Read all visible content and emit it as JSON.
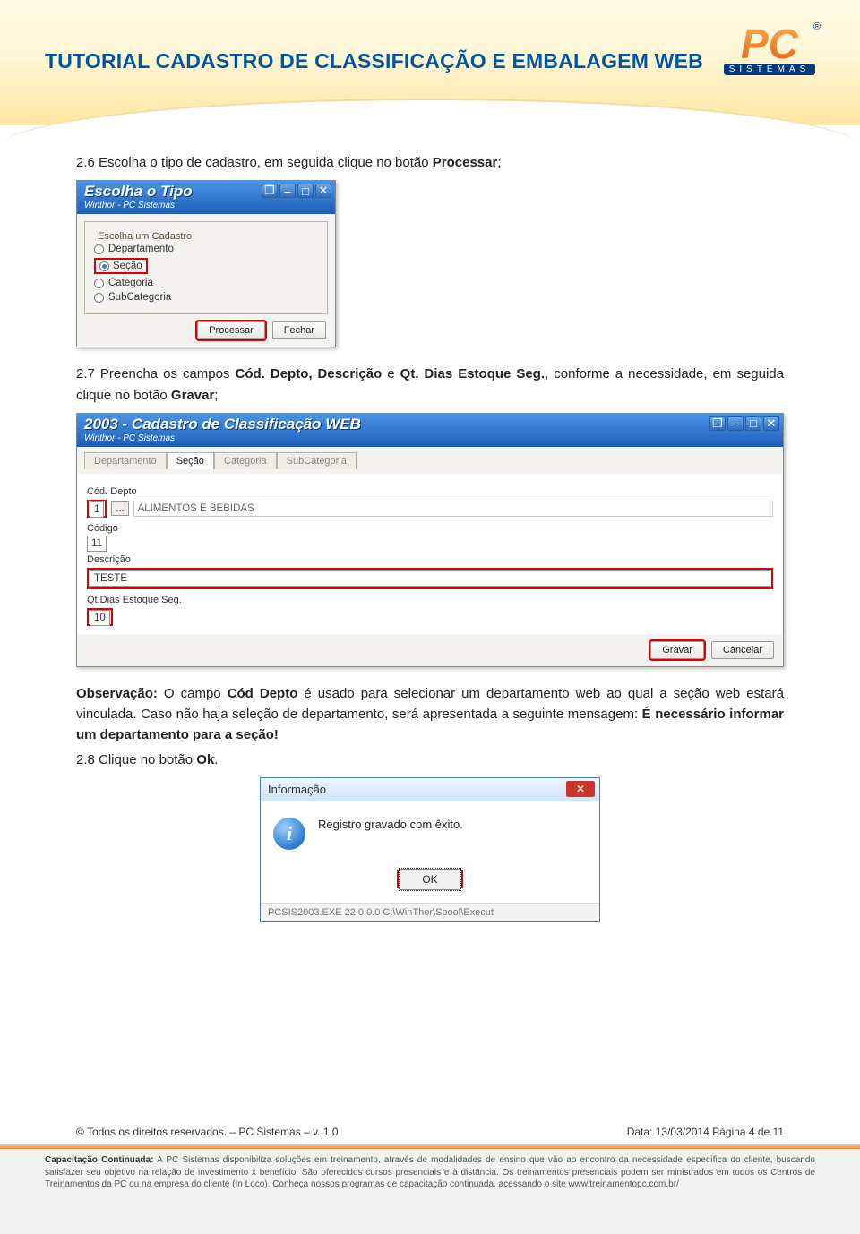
{
  "header": {
    "title": "TUTORIAL CADASTRO DE CLASSIFICAÇÃO E EMBALAGEM WEB",
    "logo_top": "PC",
    "logo_sub": "SISTEMAS"
  },
  "section26": {
    "prefix": "2.6 Escolha o tipo de cadastro, em seguida clique no botão ",
    "bold": "Processar",
    "suffix": ";"
  },
  "dialog1": {
    "title": "Escolha o Tipo",
    "subtitle": "Winthor - PC Sistemas",
    "group_label": "Escolha um Cadastro",
    "options": {
      "departamento": "Departamento",
      "secao": "Seção",
      "categoria": "Categoria",
      "subcategoria": "SubCategoria"
    },
    "btn_process": "Processar",
    "btn_close": "Fechar"
  },
  "section27": {
    "pre": "2.7 Preencha os campos ",
    "b1": "Cód. Depto, Descrição",
    "mid": " e ",
    "b2": "Qt. Dias Estoque Seg.",
    "after": ", conforme a necessidade, em seguida clique no botão ",
    "b3": "Gravar",
    "end": ";"
  },
  "dialog2": {
    "title": "2003 - Cadastro de Classificação WEB",
    "subtitle": "Winthor - PC Sistemas",
    "tabs": {
      "departamento": "Departamento",
      "secao": "Seção",
      "categoria": "Categoria",
      "subcategoria": "SubCategoria"
    },
    "labels": {
      "coddepto": "Cód. Depto",
      "codigo": "Código",
      "descricao": "Descrição",
      "qtdias": "Qt.Dias Estoque Seg."
    },
    "values": {
      "coddepto": "1",
      "lookup_btn": "...",
      "depto_name": "ALIMENTOS E BEBIDAS",
      "codigo": "11",
      "descricao": "TESTE",
      "qtdias": "10"
    },
    "btn_save": "Gravar",
    "btn_cancel": "Cancelar"
  },
  "obs": {
    "label": "Observação:",
    "t1": " O campo ",
    "b1": "Cód Depto",
    "t2": " é usado para selecionar um departamento web ao qual a seção web estará vinculada. Caso não haja seleção de departamento, será apresentada a seguinte mensagem: ",
    "b2": "É necessário informar um departamento para a seção!"
  },
  "section28": {
    "pre": "2.8 Clique no botão ",
    "bold": "Ok",
    "suffix": "."
  },
  "info": {
    "title": "Informação",
    "msg": "Registro gravado com êxito.",
    "ok": "OK",
    "status": "PCSIS2003.EXE 22.0.0.0 C:\\WinThor\\Spool\\Execut"
  },
  "footer": {
    "copy_left": "© Todos os direitos reservados. – PC Sistemas – v. 1.0",
    "copy_right": "Data: 13/03/2014     Página 4 de 11",
    "training_label": "Capacitação Continuada:",
    "training_text": " A PC Sistemas disponibiliza soluções em treinamento, através de modalidades de ensino que vão ao encontro da necessidade específica do cliente, buscando satisfazer seu objetivo na relação de investimento x benefício. São oferecidos cursos presenciais e à distância. Os treinamentos presenciais podem ser ministrados em todos os Centros de Treinamentos da PC ou na empresa do cliente (In Loco). Conheça nossos programas de capacitação continuada, acessando o site www.treinamentopc.com.br/"
  }
}
